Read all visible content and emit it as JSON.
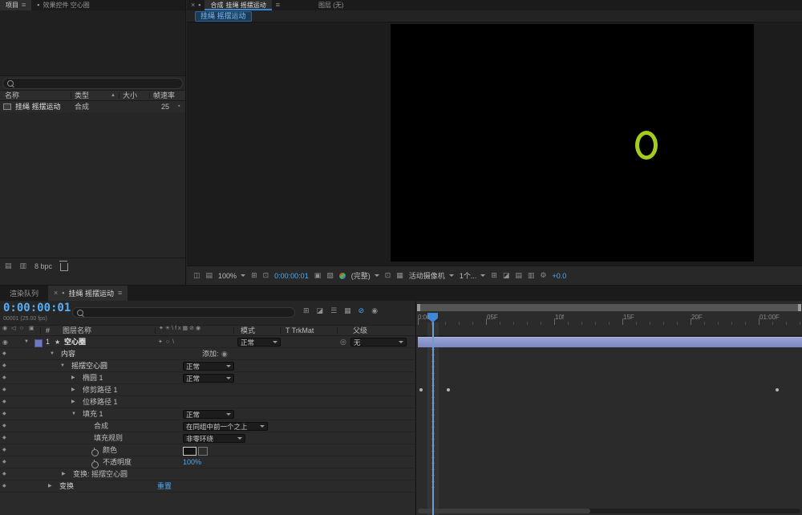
{
  "icons": {
    "menu": "≡",
    "close": "×",
    "panel": "▪",
    "twirl_open": "▼",
    "twirl_closed": "▶",
    "star": "★",
    "keyframe": "◆",
    "eye": "◉",
    "pickwhip": "◎",
    "gear": "⚙",
    "add": "◉",
    "sort_asc": "▲"
  },
  "colors": {
    "accent_blue": "#4fa8f0",
    "tab_underline": "#2f86d4",
    "layer_bar": "#8591c8",
    "shape_stroke_green": "#a3cc1d",
    "time_display": "#56aef8"
  },
  "top_tabs": {
    "project": {
      "label": "项目"
    },
    "effect_controls": {
      "label": "效果控件 空心圈"
    },
    "composition": {
      "label": "合成",
      "comp_name": "挂绳 摇摆运动"
    },
    "layer": {
      "label": "图层 (无)"
    }
  },
  "project_panel": {
    "columns": {
      "name": "名称",
      "type": "类型",
      "size": "大小",
      "framerate": "帧速率"
    },
    "items": [
      {
        "name": "挂绳 摇摆运动",
        "type": "合成",
        "framerate": "25"
      }
    ],
    "footer": {
      "bpc": "8 bpc"
    }
  },
  "comp_panel": {
    "breadcrumb": "挂绳 摇摆运动",
    "toolbar": {
      "zoom": "100%",
      "time": "0:00:00:01",
      "resolution": "(完整)",
      "view": "活动摄像机",
      "layout": "1个...",
      "exposure": "+0.0"
    }
  },
  "timeline": {
    "tabs": {
      "render_queue": "渲染队列",
      "comp": "挂绳 摇摆运动"
    },
    "current_time": "0:00:00:01",
    "time_info": "00001 (25.00 fps)",
    "ruler": [
      "0:00f",
      "05F",
      "10f",
      "15F",
      "20F",
      "01:00F"
    ],
    "columns": {
      "index": "#",
      "layer_name": "图层名称",
      "mode": "模式",
      "trkmat": "T TrkMat",
      "parent": "父级"
    },
    "add_label": "添加:",
    "rows": [
      {
        "index": "1",
        "label": "空心圈",
        "mode": "正常",
        "parent": "无"
      },
      {
        "label": "内容"
      },
      {
        "label": "摇摆空心圆",
        "mode": "正常"
      },
      {
        "label": "椭圆 1",
        "mode": "正常"
      },
      {
        "label": "修剪路径 1"
      },
      {
        "label": "位移路径 1"
      },
      {
        "label": "填充 1",
        "mode": "正常"
      },
      {
        "label": "合成",
        "value": "在同组中前一个之上"
      },
      {
        "label": "填充规则",
        "value": "非零环绕"
      },
      {
        "label": "颜色"
      },
      {
        "label": "不透明度",
        "value": "100%"
      },
      {
        "label": "变换: 摇摆空心圆"
      },
      {
        "label": "变换",
        "value": "重置"
      }
    ]
  }
}
